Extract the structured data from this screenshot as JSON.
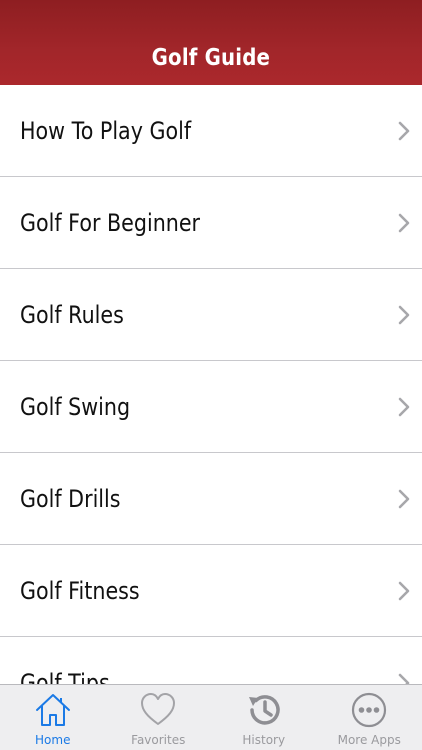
{
  "header": {
    "title": "Golf Guide"
  },
  "list": {
    "items": [
      {
        "label": "How To Play Golf"
      },
      {
        "label": "Golf For Beginner"
      },
      {
        "label": "Golf Rules"
      },
      {
        "label": "Golf Swing"
      },
      {
        "label": "Golf Drills"
      },
      {
        "label": "Golf Fitness"
      },
      {
        "label": "Golf Tips"
      }
    ]
  },
  "tabbar": {
    "tabs": [
      {
        "label": "Home",
        "icon": "home-icon",
        "active": true
      },
      {
        "label": "Favorites",
        "icon": "heart-icon",
        "active": false
      },
      {
        "label": "History",
        "icon": "history-icon",
        "active": false
      },
      {
        "label": "More Apps",
        "icon": "more-icon",
        "active": false
      }
    ]
  },
  "colors": {
    "header": "#a2262a",
    "accent": "#1b7ae6",
    "inactive": "#9a9a9e"
  }
}
